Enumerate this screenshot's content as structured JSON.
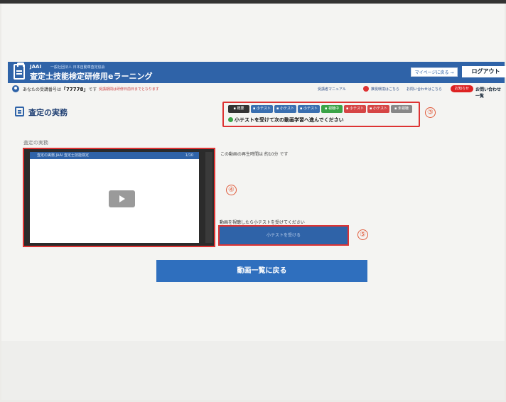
{
  "header": {
    "org": "JAAI",
    "org_sub": "一般社団法人 日本自動車査定協会",
    "title": "査定士技能検定研修用eラーニング",
    "mypage_label": "マイページに戻る →",
    "logout_label": "ログアウト"
  },
  "subbar": {
    "user_prefix": "あなたの受講番号は",
    "user_id": "「77778」",
    "user_suffix": "です",
    "note": "受講期間は研修日前日までとなります",
    "manual_link": "受講者マニュアル",
    "env_link": "推奨環境はこちら",
    "contact_link": "お問い合わせはこちら",
    "pill": "お知らせ",
    "faq_link": "お問い合わせ一覧"
  },
  "page": {
    "title": "査定の実務"
  },
  "steps": {
    "chips": [
      {
        "label": "概要",
        "color": "#333333"
      },
      {
        "label": "小テスト",
        "color": "#3a6fb0"
      },
      {
        "label": "小テスト",
        "color": "#3a6fb0"
      },
      {
        "label": "小テスト",
        "color": "#3a6fb0"
      },
      {
        "label": "視聴中",
        "color": "#3aa346"
      },
      {
        "label": "小テスト",
        "color": "#d64545"
      },
      {
        "label": "小テスト",
        "color": "#d64545"
      },
      {
        "label": "未視聴",
        "color": "#888888"
      }
    ],
    "message": "小テストを受けて次の動画学習へ進んでください",
    "callout": "③"
  },
  "video": {
    "label": "査定の実務",
    "bar_title": "査定の実務 JAAI 査定士技能検定",
    "bar_right": "1/10",
    "callout": "④"
  },
  "right": {
    "duration": "この動画の再生時間は 約10分 です",
    "quiz_hint": "動画を視聴したら小テストを受けてください",
    "quiz_button": "小テストを受ける",
    "callout": "⑤"
  },
  "back_button": "動画一覧に戻る"
}
